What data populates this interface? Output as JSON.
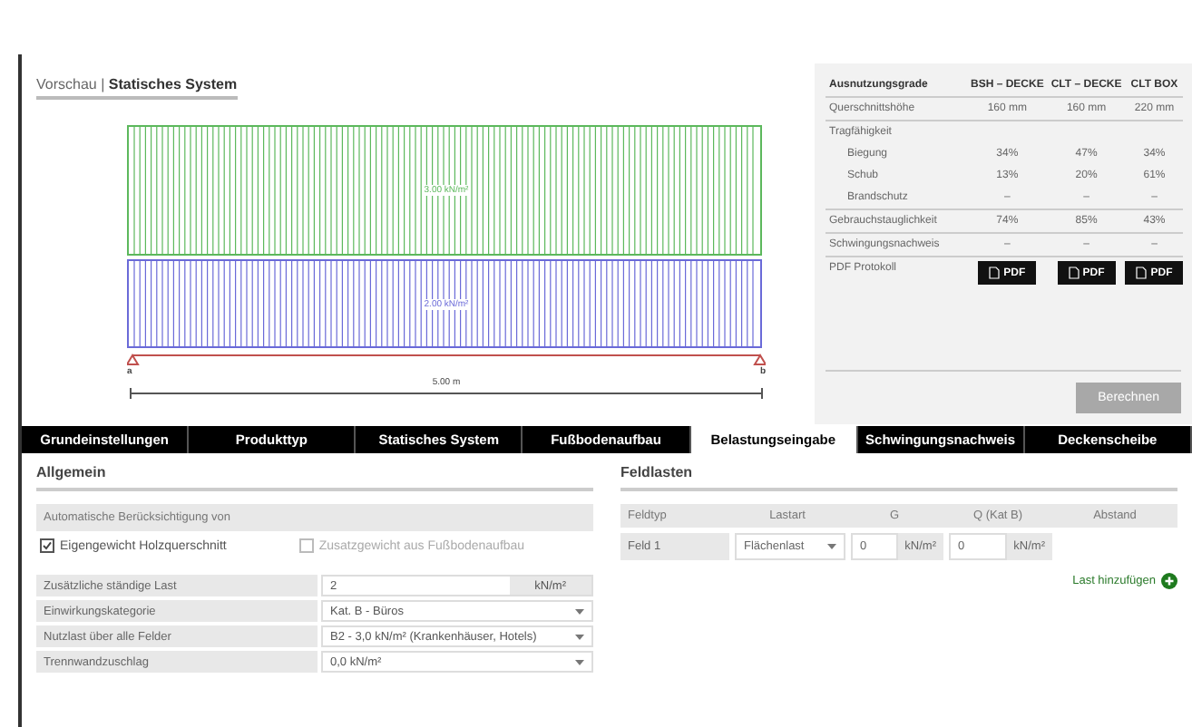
{
  "preview": {
    "prefix": "Vorschau | ",
    "title": "Statisches System",
    "loads": [
      {
        "label": "3.00 kN/m²",
        "color": "#5cb85c"
      },
      {
        "label": "2.00 kN/m²",
        "color": "#6a6ad8"
      }
    ],
    "support_left": "a",
    "support_right": "b",
    "span": "5.00 m"
  },
  "results": {
    "columns": [
      "Ausnutzungsgrade",
      "BSH – DECKE",
      "CLT – DECKE",
      "CLT BOX"
    ],
    "rows": [
      {
        "kind": "row",
        "cells": [
          "Querschnittshöhe",
          "160 mm",
          "160 mm",
          "220 mm"
        ]
      },
      {
        "kind": "group",
        "cells": [
          "Tragfähigkeit"
        ]
      },
      {
        "kind": "sub",
        "cells": [
          "Biegung",
          "34%",
          "47%",
          "34%"
        ]
      },
      {
        "kind": "sub",
        "cells": [
          "Schub",
          "13%",
          "20%",
          "61%"
        ]
      },
      {
        "kind": "sub",
        "cells": [
          "Brandschutz",
          "–",
          "–",
          "–"
        ]
      },
      {
        "kind": "row",
        "cells": [
          "Gebrauchstauglichkeit",
          "74%",
          "85%",
          "43%"
        ]
      },
      {
        "kind": "row",
        "cells": [
          "Schwingungsnachweis",
          "–",
          "–",
          "–"
        ]
      }
    ],
    "pdf_label": "PDF Protokoll",
    "pdf_buttons": [
      "PDF",
      "PDF",
      "PDF"
    ],
    "calculate": {
      "label": "Berechnen",
      "disabled": true
    }
  },
  "tabs": [
    {
      "label": "Grundeinstellungen",
      "selected": false
    },
    {
      "label": "Produkttyp",
      "selected": false
    },
    {
      "label": "Statisches System",
      "selected": false
    },
    {
      "label": "Fußbodenaufbau",
      "selected": false
    },
    {
      "label": "Belastungseingabe",
      "selected": true
    },
    {
      "label": "Schwingungsnachweis",
      "selected": false
    },
    {
      "label": "Deckenscheibe",
      "selected": false
    }
  ],
  "general": {
    "title": "Allgemein",
    "auto_heading": "Automatische Berücksichtigung von",
    "checkboxes": [
      {
        "label": "Eigengewicht Holzquerschnitt",
        "checked": true,
        "disabled": false
      },
      {
        "label": "Zusatzgewicht aus Fußbodenaufbau",
        "checked": false,
        "disabled": true
      }
    ],
    "fields": [
      {
        "kind": "input",
        "label": "Zusätzliche ständige Last",
        "value": "2",
        "unit": "kN/m²"
      },
      {
        "kind": "select",
        "label": "Einwirkungskategorie",
        "value": "Kat. B - Büros"
      },
      {
        "kind": "select",
        "label": "Nutzlast über alle Felder",
        "value": "B2 - 3,0 kN/m² (Krankenhäuser, Hotels)"
      },
      {
        "kind": "select",
        "label": "Trennwandzuschlag",
        "value": "0,0 kN/m²"
      }
    ]
  },
  "field_loads": {
    "title": "Feldlasten",
    "columns": [
      "Feldtyp",
      "Lastart",
      "G",
      "Q (Kat B)",
      "Abstand"
    ],
    "rows": [
      {
        "field": "Feld 1",
        "type": "Flächenlast",
        "g": "0",
        "g_unit": "kN/m²",
        "q": "0",
        "q_unit": "kN/m²"
      }
    ],
    "add": "Last hinzufügen"
  }
}
